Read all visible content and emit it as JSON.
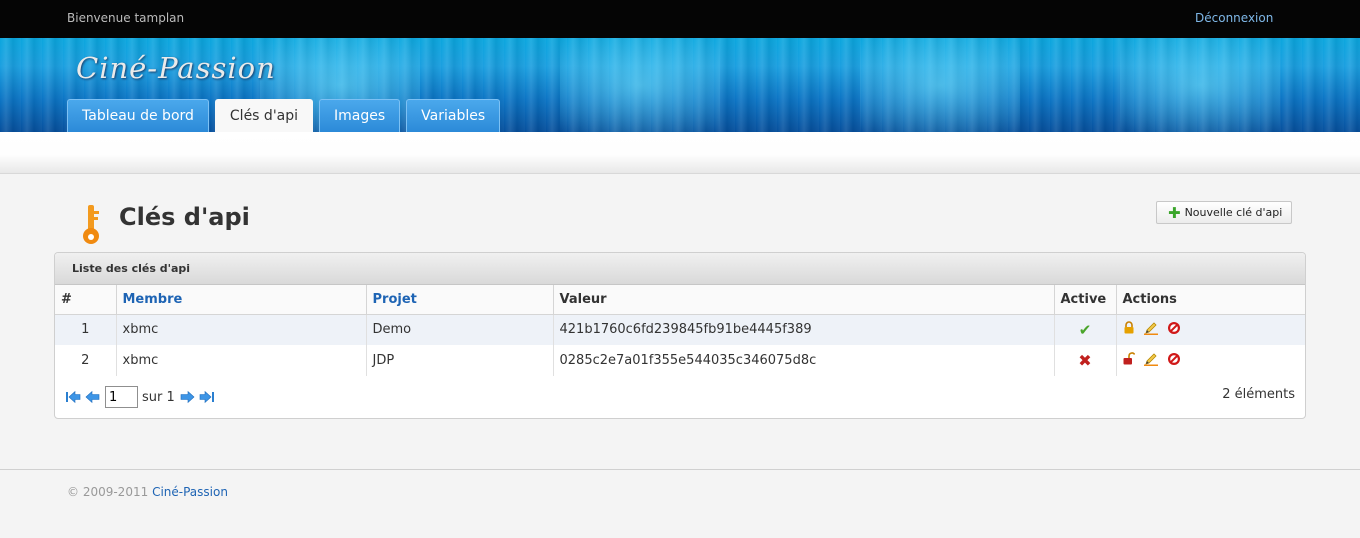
{
  "topbar": {
    "welcome": "Bienvenue tamplan",
    "logout": "Déconnexion"
  },
  "brand": {
    "logo": "Ciné-Passion"
  },
  "tabs": [
    {
      "label": "Tableau de bord",
      "active": false
    },
    {
      "label": "Clés d'api",
      "active": true
    },
    {
      "label": "Images",
      "active": false
    },
    {
      "label": "Variables",
      "active": false
    }
  ],
  "page": {
    "title": "Clés d'api",
    "new_button": "Nouvelle clé d'api",
    "icon": "key-icon"
  },
  "panel": {
    "title": "Liste des clés d'api",
    "columns": [
      "#",
      "Membre",
      "Projet",
      "Valeur",
      "Active",
      "Actions"
    ],
    "rows": [
      {
        "num": "1",
        "member": "xbmc",
        "project": "Demo",
        "value": "421b1760c6fd239845fb91be4445f389",
        "active": true
      },
      {
        "num": "2",
        "member": "xbmc",
        "project": "JDP",
        "value": "0285c2e7a01f355e544035c346075d8c",
        "active": false
      }
    ],
    "pager": {
      "page": "1",
      "of_label": "sur 1"
    },
    "count": "2 éléments"
  },
  "footer": {
    "copyright": "© 2009-2011",
    "link": "Ciné-Passion"
  },
  "colors": {
    "accent": "#1e64b4",
    "banner": "#0b74c4",
    "active_ok": "#4aa52a",
    "active_no": "#c0201e"
  }
}
